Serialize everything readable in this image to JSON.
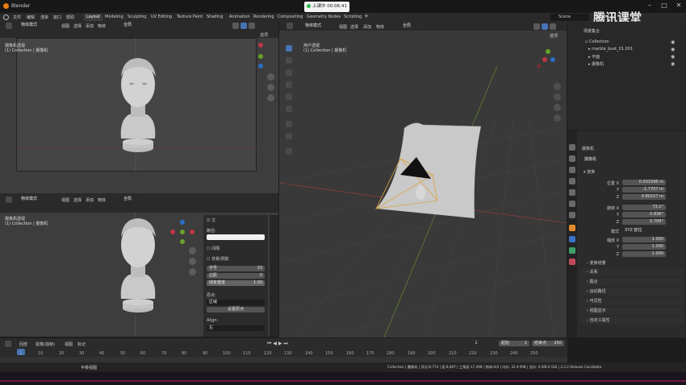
{
  "window": {
    "title": "Blender",
    "recording": "上课中 00:06:41"
  },
  "menu": {
    "file": "文件",
    "edit": "编辑",
    "render": "渲染",
    "window": "窗口",
    "help": "帮助"
  },
  "workspaces": [
    "Layout",
    "Modeling",
    "Sculpting",
    "UV Editing",
    "Texture Paint",
    "Shading",
    "Animation",
    "Rendering",
    "Compositing",
    "Geometry Nodes",
    "Scripting"
  ],
  "scene": {
    "name": "Scene",
    "watermark": "腾讯课堂"
  },
  "header": {
    "mode": "物体模式",
    "view": "视图",
    "select": "选择",
    "add": "添加",
    "object": "物体",
    "global": "全局",
    "options": "选项"
  },
  "viewport_top": {
    "title": "摄像机透视",
    "collection": "(1) Collection | 摄像机"
  },
  "viewport_bottom": {
    "title": "摄像机透视",
    "collection": "(1) Collection | 摄像机"
  },
  "viewport_main": {
    "title": "用户透视",
    "collection": "(1) Collection | 摄像机"
  },
  "text_panel": {
    "header": "文",
    "text_label": "路径:",
    "check1": "间隔",
    "check2": "背景/阴影",
    "size_label": "字号",
    "size_value": "33",
    "margin_label": "边距",
    "margin_value": "0",
    "linewidth_label": "线条宽度",
    "linewidth_value": "1.00",
    "origin_label": "原点:",
    "origin_value": "区域",
    "set_origin": "设置原点",
    "align_label": "Align:",
    "align_value": "左"
  },
  "outliner": {
    "title": "场景集合",
    "items": [
      {
        "name": "Collection"
      },
      {
        "name": "marble_bust_01.001"
      },
      {
        "name": "平面"
      },
      {
        "name": "摄像机"
      }
    ]
  },
  "properties": {
    "object_name": "摄像机",
    "data_name": "摄像机",
    "transform_label": "变换",
    "location": {
      "label": "位置 X",
      "x": "0.031596 m",
      "y": "-1.7707 m",
      "z": "0.80157 m"
    },
    "rotation": {
      "label": "旋转 X",
      "x": "73.1°",
      "y": "0.836°",
      "z": "0.709°"
    },
    "mode_label": "模式",
    "mode_value": "XYZ 欧拉",
    "scale": {
      "label": "缩放 X",
      "x": "1.000",
      "y": "1.000",
      "z": "1.000"
    },
    "y_label": "Y",
    "z_label": "Z",
    "delta_label": "变换增量",
    "sections": [
      "关系",
      "集合",
      "运动路径",
      "可见性",
      "视图显示",
      "自定义属性"
    ]
  },
  "timeline": {
    "play": "回放",
    "keying": "抠像(插帧)",
    "view": "视图",
    "marker": "标记",
    "current": "1",
    "start_label": "起始",
    "start": "1",
    "end_label": "结束点",
    "end": "250",
    "ticks": [
      "1",
      "10",
      "20",
      "30",
      "40",
      "50",
      "60",
      "70",
      "80",
      "90",
      "100",
      "110",
      "120",
      "130",
      "140",
      "150",
      "160",
      "170",
      "180",
      "190",
      "200",
      "210",
      "220",
      "230",
      "240",
      "250"
    ]
  },
  "status": {
    "left": "平移视图",
    "right": "Collection | 摄像机 | 顶点:8,774 | 面:8,897 | 三角面:17,498 | 物体:0/4 | 内存: 32.9 MiB | 显存: 0.9/8.0 GiB | 3.3.2 Release Candidate"
  }
}
